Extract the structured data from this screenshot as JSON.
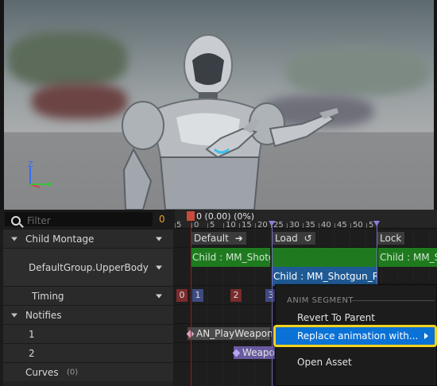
{
  "sidebar": {
    "filter_placeholder": "Filter",
    "filter_count": "0",
    "child_montage": "Child Montage",
    "slot_group": "DefaultGroup.UpperBody",
    "timing": "Timing",
    "notifies": "Notifies",
    "notify_track_1": "1",
    "notify_track_2": "2",
    "curves": "Curves",
    "curves_count": "(0)"
  },
  "ruler": {
    "time_readout": "0 (0.00) (0%)",
    "ticks": [
      "5",
      "0",
      "5",
      "10",
      "15",
      "20",
      "25",
      "30",
      "35",
      "40",
      "45",
      "50",
      "5"
    ]
  },
  "sections": {
    "default": "Default",
    "load": "Load",
    "lock": "Lock"
  },
  "segments": {
    "child_a": "Child : MM_Shotgu",
    "child_b": "Child : MM_Shotgun_Re",
    "child_c": "Child : MM_S"
  },
  "timing_markers": [
    "0",
    "1",
    "2",
    "3"
  ],
  "notifies": {
    "n1": "AN_PlayWeapon",
    "n2": "Weapo"
  },
  "context_menu": {
    "header": "ANIM SEGMENT",
    "revert": "Revert To Parent",
    "replace": "Replace animation with...",
    "open": "Open Asset"
  },
  "colors": {
    "highlight": "#0a72d6",
    "highlight_outline": "#f2d21e",
    "segment_green": "#1f7a1f",
    "segment_blue": "#1f5a94",
    "filter_count": "#e89b2f"
  }
}
